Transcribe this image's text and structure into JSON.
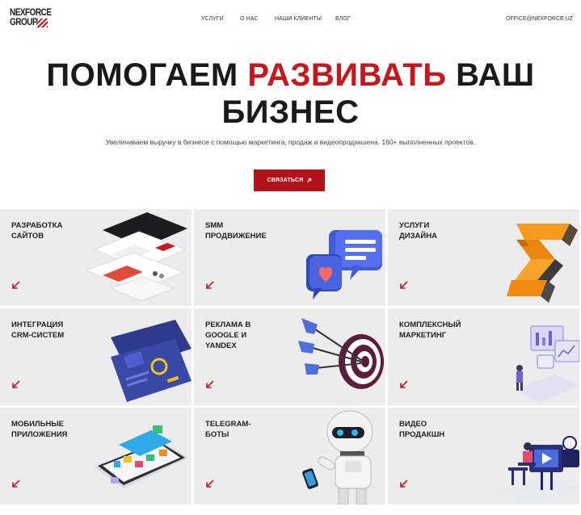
{
  "header": {
    "logo_line1": "NEXFORCE",
    "logo_line2": "GROUP",
    "nav": [
      "УСЛУГИ",
      "О НАС",
      "НАШИ КЛИЕНТЫ",
      "БЛОГ"
    ],
    "email": "OFFICE@NEXFORCE.UZ"
  },
  "hero": {
    "title_part1": "ПОМОГАЕМ ",
    "title_accent": "РАЗВИВАТЬ",
    "title_part2": " ВАШ БИЗНЕС",
    "subtitle": "Увеличиваем выручку в бизнесе с помощью маркетинга, продаж и видеопродакшена. 160+ выполненных проектов.",
    "cta_label": "СВЯЗАТЬСЯ",
    "cta_icon": "arrow-up-right-icon"
  },
  "services": [
    {
      "label": "РАЗРАБОТКА\nСАЙТОВ",
      "icon": "website-mockups-illustration"
    },
    {
      "label": "SMM\nПРОДВИЖЕНИЕ",
      "icon": "chat-bubbles-heart-illustration"
    },
    {
      "label": "УСЛУГИ\nДИЗАЙНА",
      "icon": "3d-letter-s-illustration"
    },
    {
      "label": "ИНТЕГРАЦИЯ\nCRM-СИСТЕМ",
      "icon": "crm-dashboard-illustration"
    },
    {
      "label": "РЕКЛАМА В\nGOOGLE И\nYANDEX",
      "icon": "target-darts-illustration"
    },
    {
      "label": "КОМПЛЕКСНЫЙ\nМАРКЕТИНГ",
      "icon": "analytics-screens-illustration"
    },
    {
      "label": "МОБИЛЬНЫЕ\nПРИЛОЖЕНИЯ",
      "icon": "smartphone-apps-illustration"
    },
    {
      "label": "TELEGRAM-\nБОТЫ",
      "icon": "robot-illustration"
    },
    {
      "label": "ВИДЕО\nПРОДАКШН",
      "icon": "video-camera-illustration"
    }
  ],
  "colors": {
    "accent": "#c8161d",
    "button": "#b3121b",
    "card_bg": "#ececec",
    "text": "#1a1a1a"
  }
}
